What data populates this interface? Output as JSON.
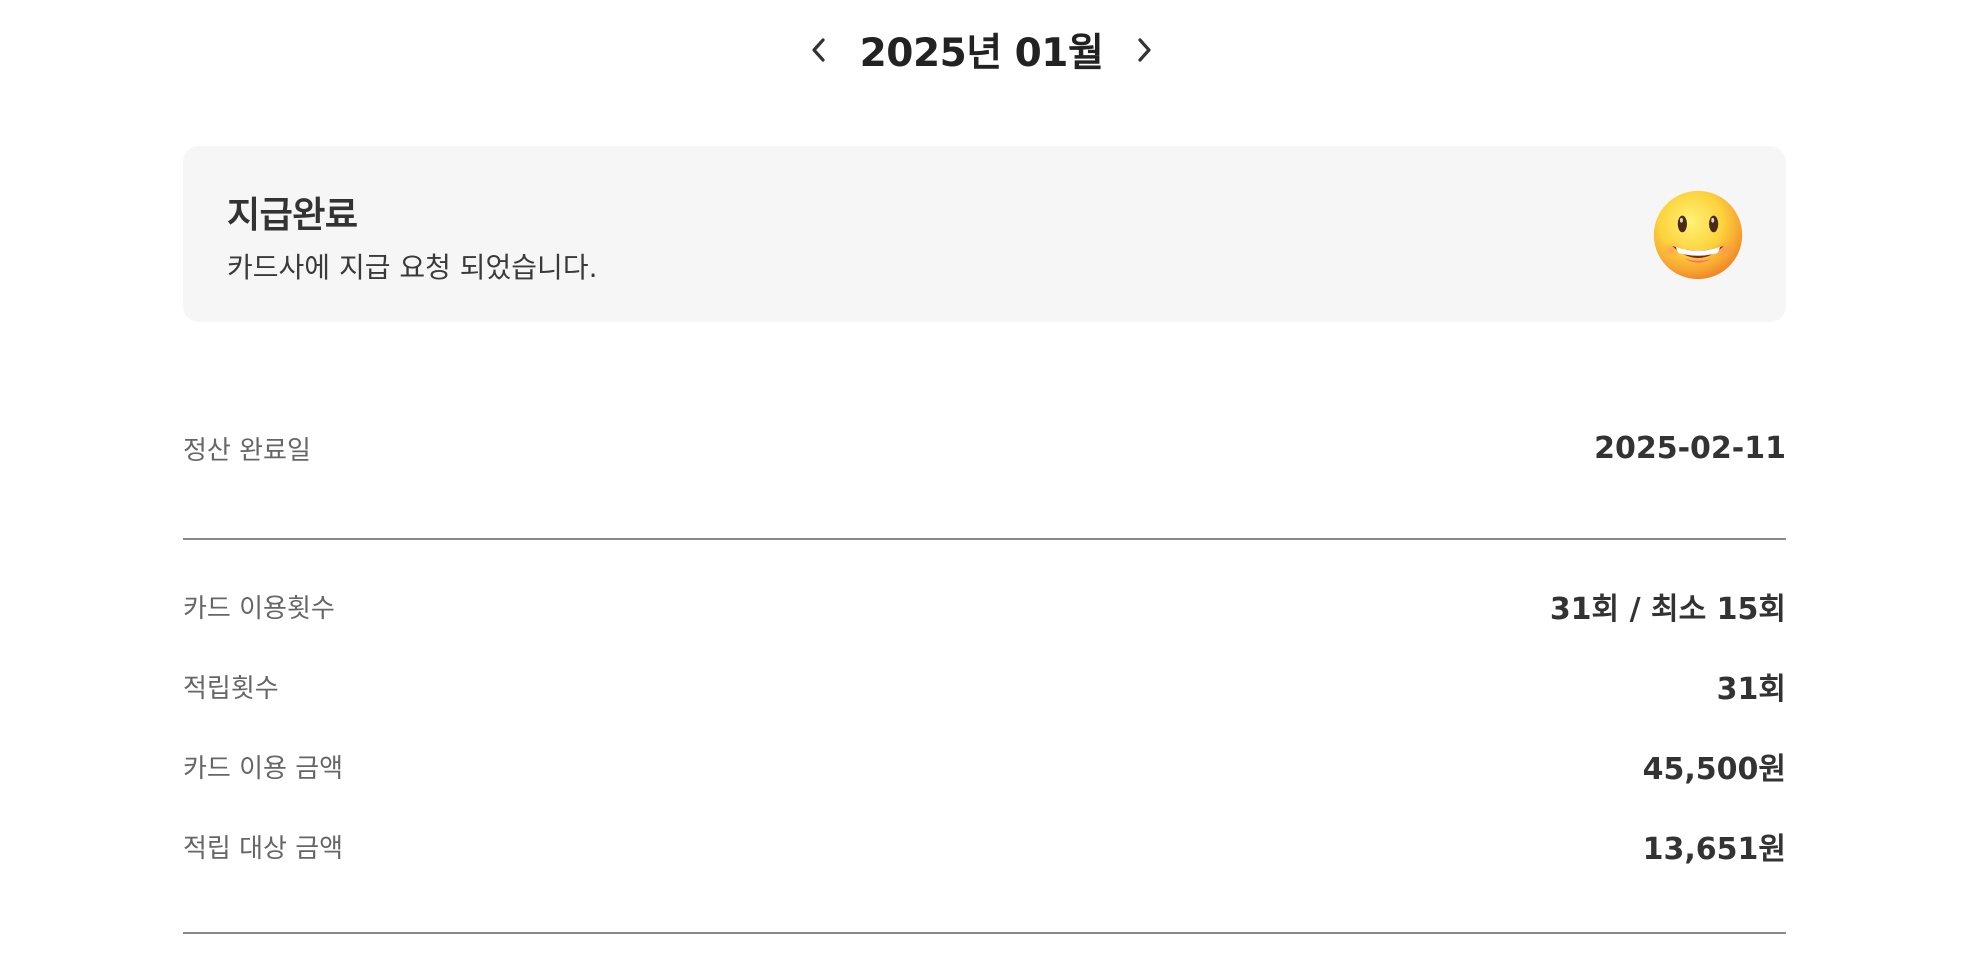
{
  "header": {
    "month_label": "2025년 01월"
  },
  "status_card": {
    "title": "지급완료",
    "description": "카드사에 지급 요청 되었습니다.",
    "icon": "smiling-face-emoji"
  },
  "settlement": {
    "label": "정산 완료일",
    "value": "2025-02-11"
  },
  "details": [
    {
      "label": "카드 이용횟수",
      "value": "31회 / 최소 15회"
    },
    {
      "label": "적립횟수",
      "value": "31회"
    },
    {
      "label": "카드 이용 금액",
      "value": "45,500원"
    },
    {
      "label": "적립 대상 금액",
      "value": "13,651원"
    }
  ]
}
